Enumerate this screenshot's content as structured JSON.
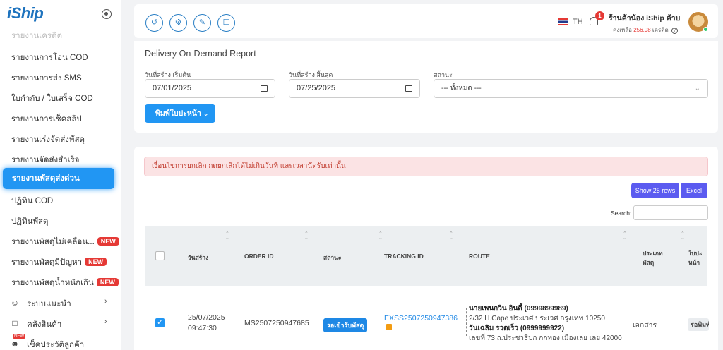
{
  "sidebar": {
    "logo": "iShip",
    "faded_item": "รายงานเครดิต",
    "items": [
      {
        "label": "รายงานการโอน COD"
      },
      {
        "label": "รายงานการส่ง SMS"
      },
      {
        "label": "ใบกำกับ / ใบเสร็จ COD"
      },
      {
        "label": "รายงานการเช็คสลิป"
      },
      {
        "label": "รายงานเร่งจัดส่งพัสดุ"
      },
      {
        "label": "รายงานจัดส่งสำเร็จ"
      },
      {
        "label": "รายงานพัสดุส่งด่วน"
      },
      {
        "label": "ปฏิทิน COD"
      },
      {
        "label": "ปฏิทินพัสดุ"
      },
      {
        "label": "รายงานพัสดุไม่เคลื่อน...",
        "badge": "NEW"
      },
      {
        "label": "รายงานพัสดุมีปัญหา",
        "badge": "NEW"
      },
      {
        "label": "รายงานพัสดุน้ำหนักเกิน",
        "badge": "NEW"
      }
    ],
    "groups": [
      {
        "label": "ระบบแนะนำ",
        "icon": "users-icon"
      },
      {
        "label": "คลังสินค้า",
        "icon": "bag-icon"
      },
      {
        "label": "เช็คประวัติลูกค้า",
        "icon": "user-icon",
        "mini_badge": "NEW"
      }
    ]
  },
  "topbar": {
    "lang": "TH",
    "notification_count": "1",
    "shop_name": "ร้านค้าน้อง iShip ค้าบ",
    "credit_label": "คงเหลือ",
    "credit_amount": "256.98",
    "credit_unit": "เครดิต"
  },
  "filters": {
    "title": "Delivery On-Demand Report",
    "start_label": "วันที่สร้าง เริ่มต้น",
    "start_value": "07/01/2025",
    "end_label": "วันที่สร้าง สิ้นสุด",
    "end_value": "07/25/2025",
    "status_label": "สถานะ",
    "status_value": "--- ทั้งหมด ---",
    "print_button": "พิมพ์ใบปะหน้า"
  },
  "report": {
    "alert_link": "เงื่อนไขการยกเลิก",
    "alert_text": " กดยกเลิกได้ไม่เกินวันที่ และเวลานัดรับเท่านั้น",
    "show_rows_button": "Show 25 rows",
    "excel_button": "Excel",
    "search_label": "Search:",
    "columns": [
      "วันสร้าง",
      "ORDER ID",
      "สถานะ",
      "TRACKING ID",
      "ROUTE",
      "ประเภท",
      "พัสดุ",
      "ใบปะ",
      "หน้า"
    ],
    "rows": [
      {
        "date": "25/07/2025",
        "time": "09:47:30",
        "order_id": "MS2507250947685",
        "status": "รอเข้ารับพัสดุ",
        "tracking_id": "EXSS2507250947386",
        "sender_name": "นายเพนกวิน อินดี้ (0999899989)",
        "sender_address": "2/32 H.Cape ประเวศ ประเวศ กรุงเทพ 10250",
        "receiver_name": "วันเฉลิม รวดเร็ว (0999999922)",
        "receiver_address": "เลขที่ 73 ถ.ประชาธิปก กกทอง เมืองเลย เลย 42000",
        "parcel_type": "เอกสาร",
        "label_status": "รอพิมพ์"
      }
    ]
  }
}
